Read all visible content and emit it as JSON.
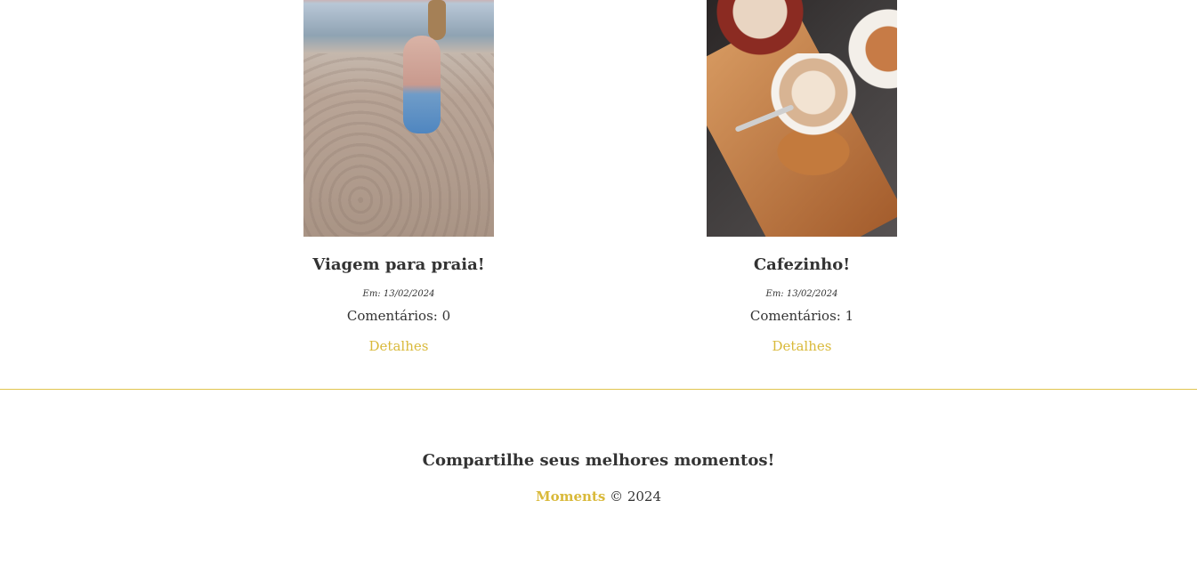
{
  "posts": [
    {
      "title": "Viagem para praia!",
      "date": "Em: 13/02/2024",
      "comments": "Comentários: 0",
      "link": "Detalhes",
      "image_subject": "woman sitting on beach sand"
    },
    {
      "title": "Cafezinho!",
      "date": "Em: 13/02/2024",
      "comments": "Comentários: 1",
      "link": "Detalhes",
      "image_subject": "two latte cups on wooden tray"
    }
  ],
  "footer": {
    "tagline": "Compartilhe seus melhores momentos!",
    "brand": "Moments",
    "copyright": "© 2024"
  },
  "colors": {
    "accent": "#d9b93a",
    "divider": "#e1c54f",
    "text": "#333333",
    "background": "#ffffff"
  }
}
